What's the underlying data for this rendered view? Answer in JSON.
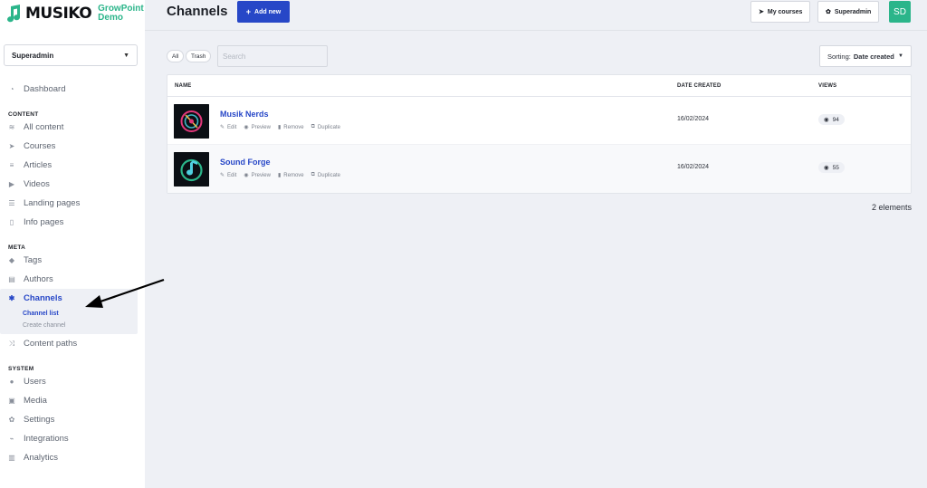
{
  "brand": {
    "name": "MUSIKO",
    "sub_line1": "GrowPoint",
    "sub_line2": "Demo"
  },
  "role_select": {
    "value": "Superadmin"
  },
  "nav": {
    "dashboard": "Dashboard",
    "content_heading": "CONTENT",
    "all_content": "All content",
    "courses": "Courses",
    "articles": "Articles",
    "videos": "Videos",
    "landing_pages": "Landing pages",
    "info_pages": "Info pages",
    "meta_heading": "META",
    "tags": "Tags",
    "authors": "Authors",
    "channels": "Channels",
    "channel_list": "Channel list",
    "create_channel": "Create channel",
    "content_paths": "Content paths",
    "system_heading": "SYSTEM",
    "users": "Users",
    "media": "Media",
    "settings": "Settings",
    "integrations": "Integrations",
    "analytics": "Analytics"
  },
  "header": {
    "title": "Channels",
    "add_new": "Add new",
    "my_courses": "My courses",
    "superadmin": "Superadmin",
    "avatar_initials": "SD"
  },
  "filters": {
    "all": "All",
    "trash": "Trash",
    "search_placeholder": "Search",
    "sorting_label": "Sorting:",
    "sorting_value": "Date created"
  },
  "table": {
    "columns": {
      "name": "NAME",
      "date_created": "DATE CREATED",
      "views": "VIEWS"
    },
    "rows": [
      {
        "title": "Musik Nerds",
        "date": "16/02/2024",
        "views": "94"
      },
      {
        "title": "Sound Forge",
        "date": "16/02/2024",
        "views": "55"
      }
    ],
    "actions": {
      "edit": "Edit",
      "preview": "Preview",
      "remove": "Remove",
      "duplicate": "Duplicate"
    }
  },
  "footer": {
    "count": "2 elements"
  },
  "colors": {
    "accent": "#2747c7",
    "brand_green": "#2bb58a"
  }
}
